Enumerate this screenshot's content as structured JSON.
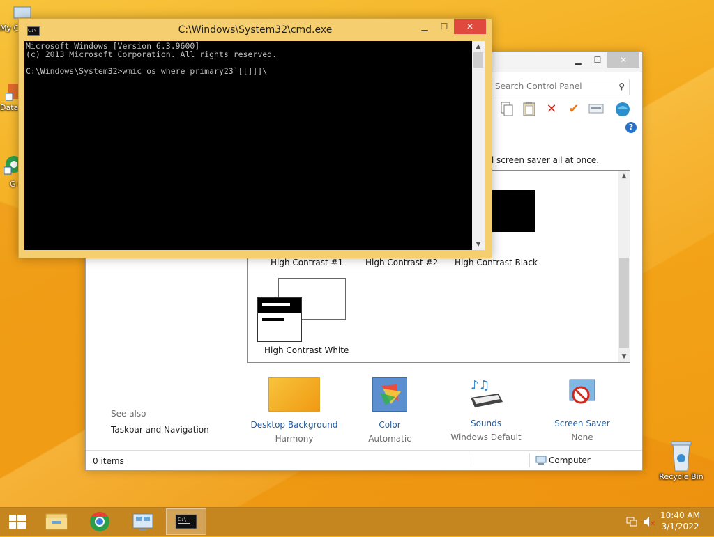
{
  "desktop": {
    "icons": [
      {
        "label": "My C"
      },
      {
        "label": "Data"
      },
      {
        "label": "G C"
      },
      {
        "label": "Recycle Bin"
      }
    ]
  },
  "control_panel": {
    "search_placeholder": "Search Control Panel",
    "description": "nd screen saver all at once.",
    "themes": [
      "High Contrast #1",
      "High Contrast #2",
      "High Contrast Black",
      "High Contrast White"
    ],
    "see_also_label": "See also",
    "see_also_link": "Taskbar and Navigation",
    "personalize": [
      {
        "label": "Desktop Background",
        "sub": "Harmony"
      },
      {
        "label": "Color",
        "sub": "Automatic"
      },
      {
        "label": "Sounds",
        "sub": "Windows Default"
      },
      {
        "label": "Screen Saver",
        "sub": "None"
      }
    ],
    "status_items": "0 items",
    "status_computer": "Computer"
  },
  "cmd": {
    "title": "C:\\Windows\\System32\\cmd.exe",
    "icon_text": "C:\\",
    "lines": [
      "Microsoft Windows [Version 6.3.9600]",
      "(c) 2013 Microsoft Corporation. All rights reserved.",
      "",
      "C:\\Windows\\System32>wmic os where primary23`[[]]]\\"
    ]
  },
  "taskbar": {
    "time": "10:40 AM",
    "date": "3/1/2022"
  },
  "colors": {
    "cmd_frame": "#f5cf6f",
    "taskbar": "#c58620",
    "link_blue": "#1e5fa8"
  }
}
